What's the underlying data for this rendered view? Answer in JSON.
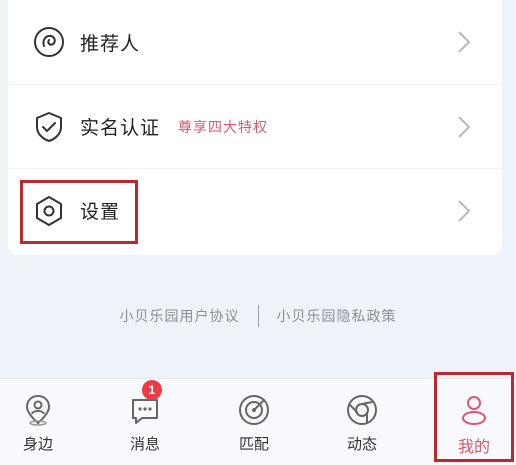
{
  "menu": {
    "items": [
      {
        "label": "推荐人",
        "sub": "",
        "icon": "referrer-icon"
      },
      {
        "label": "实名认证",
        "sub": "尊享四大特权",
        "icon": "shield-check-icon"
      },
      {
        "label": "设置",
        "sub": "",
        "icon": "settings-hexagon-icon"
      }
    ]
  },
  "links": {
    "user_agreement": "小贝乐园用户协议",
    "privacy_policy": "小贝乐园隐私政策"
  },
  "tabbar": {
    "tabs": [
      {
        "label": "身边",
        "icon": "location-person-icon"
      },
      {
        "label": "消息",
        "icon": "message-icon",
        "badge": "1"
      },
      {
        "label": "匹配",
        "icon": "match-radar-icon"
      },
      {
        "label": "动态",
        "icon": "moments-icon"
      },
      {
        "label": "我的",
        "icon": "profile-icon"
      }
    ],
    "active": "我的"
  },
  "colors": {
    "accent": "#e2546c",
    "highlight_box": "#c0262e",
    "badge": "#ec3b44"
  }
}
